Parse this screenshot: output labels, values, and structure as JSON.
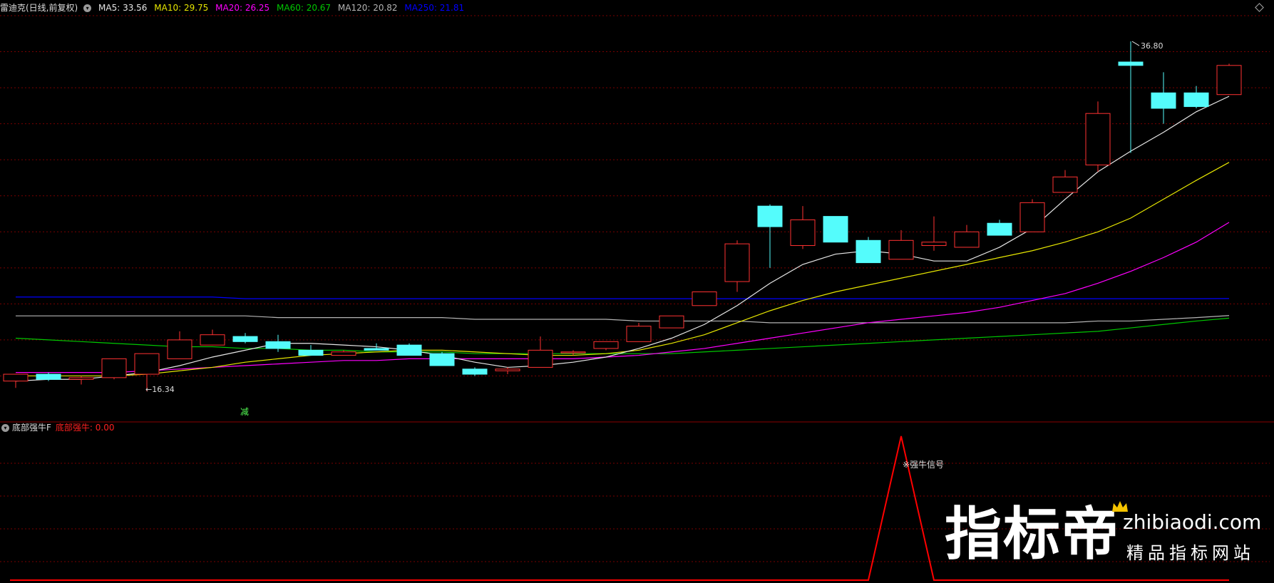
{
  "header": {
    "stock": "雷迪克(日线,前复权)",
    "ma5": "MA5: 33.56",
    "ma10": "MA10: 29.75",
    "ma20": "MA20: 26.25",
    "ma60": "MA60: 20.67",
    "ma120": "MA120: 20.82",
    "ma250": "MA250: 21.81"
  },
  "colors": {
    "up": "#ff3232",
    "down": "#54fcfc",
    "ma5": "#e6e6e6",
    "ma10": "#e6e600",
    "ma20": "#ff00ff",
    "ma60": "#00c800",
    "ma120": "#b4b4b4",
    "ma250": "#0000ff",
    "grid": "#7a0000",
    "signal": "#ff0000"
  },
  "annotations": {
    "high": "36.80",
    "low": "16.34",
    "reduce": "减"
  },
  "indicator": {
    "name": "底部强牛F",
    "label": "底部强牛: 0.00",
    "signal_text": "※强牛信号"
  },
  "watermark": {
    "brand": "指标帝",
    "url": "zhibiaodi.com",
    "tagline": "精品指标网站"
  },
  "chart_data": {
    "type": "candlestick",
    "ylim": [
      15.2,
      38.3
    ],
    "candles": [
      {
        "o": 17.0,
        "h": 17.4,
        "l": 16.6,
        "c": 17.4
      },
      {
        "o": 17.4,
        "h": 17.5,
        "l": 17.0,
        "c": 17.1
      },
      {
        "o": 17.1,
        "h": 17.3,
        "l": 16.8,
        "c": 17.2
      },
      {
        "o": 17.2,
        "h": 18.3,
        "l": 17.1,
        "c": 18.3
      },
      {
        "o": 17.4,
        "h": 18.6,
        "l": 16.4,
        "c": 18.6
      },
      {
        "o": 18.3,
        "h": 19.9,
        "l": 18.3,
        "c": 19.4
      },
      {
        "o": 19.1,
        "h": 20.0,
        "l": 19.1,
        "c": 19.7
      },
      {
        "o": 19.6,
        "h": 19.8,
        "l": 19.2,
        "c": 19.3
      },
      {
        "o": 19.3,
        "h": 19.7,
        "l": 18.7,
        "c": 18.9
      },
      {
        "o": 18.8,
        "h": 19.1,
        "l": 18.5,
        "c": 18.5
      },
      {
        "o": 18.5,
        "h": 18.8,
        "l": 18.5,
        "c": 18.7
      },
      {
        "o": 18.9,
        "h": 19.2,
        "l": 18.8,
        "c": 18.8
      },
      {
        "o": 19.1,
        "h": 19.2,
        "l": 18.5,
        "c": 18.5
      },
      {
        "o": 18.6,
        "h": 18.7,
        "l": 17.9,
        "c": 17.9
      },
      {
        "o": 17.7,
        "h": 17.8,
        "l": 17.3,
        "c": 17.4
      },
      {
        "o": 17.6,
        "h": 17.8,
        "l": 17.4,
        "c": 17.7
      },
      {
        "o": 17.8,
        "h": 19.6,
        "l": 17.8,
        "c": 18.8
      },
      {
        "o": 18.7,
        "h": 18.8,
        "l": 18.5,
        "c": 18.7
      },
      {
        "o": 18.9,
        "h": 19.3,
        "l": 18.8,
        "c": 19.3
      },
      {
        "o": 19.3,
        "h": 20.4,
        "l": 19.3,
        "c": 20.2
      },
      {
        "o": 20.1,
        "h": 20.8,
        "l": 20.1,
        "c": 20.8
      },
      {
        "o": 21.4,
        "h": 22.2,
        "l": 21.4,
        "c": 22.2
      },
      {
        "o": 22.8,
        "h": 25.2,
        "l": 22.2,
        "c": 25.0
      },
      {
        "o": 27.2,
        "h": 27.3,
        "l": 23.6,
        "c": 26.0
      },
      {
        "o": 24.9,
        "h": 27.2,
        "l": 24.7,
        "c": 26.4
      },
      {
        "o": 26.6,
        "h": 26.6,
        "l": 25.1,
        "c": 25.1
      },
      {
        "o": 25.2,
        "h": 25.4,
        "l": 23.9,
        "c": 23.9
      },
      {
        "o": 24.1,
        "h": 25.8,
        "l": 24.1,
        "c": 25.2
      },
      {
        "o": 24.9,
        "h": 26.6,
        "l": 24.6,
        "c": 25.1
      },
      {
        "o": 24.8,
        "h": 26.1,
        "l": 24.8,
        "c": 25.7
      },
      {
        "o": 26.2,
        "h": 26.4,
        "l": 25.5,
        "c": 25.5
      },
      {
        "o": 25.7,
        "h": 27.6,
        "l": 25.7,
        "c": 27.4
      },
      {
        "o": 28.0,
        "h": 29.3,
        "l": 28.0,
        "c": 28.9
      },
      {
        "o": 29.6,
        "h": 33.3,
        "l": 29.2,
        "c": 32.6
      },
      {
        "o": 35.6,
        "h": 36.8,
        "l": 30.3,
        "c": 35.4
      },
      {
        "o": 33.8,
        "h": 35.0,
        "l": 32.0,
        "c": 32.9
      },
      {
        "o": 33.8,
        "h": 34.2,
        "l": 32.9,
        "c": 33.0
      },
      {
        "o": 33.7,
        "h": 35.5,
        "l": 33.7,
        "c": 35.4
      }
    ],
    "ma5": [
      17.0,
      17.1,
      17.1,
      17.3,
      17.5,
      17.9,
      18.4,
      18.8,
      19.2,
      19.2,
      19.1,
      19.0,
      18.8,
      18.5,
      18.1,
      17.8,
      17.9,
      18.1,
      18.4,
      18.9,
      19.5,
      20.3,
      21.4,
      22.7,
      23.8,
      24.4,
      24.6,
      24.4,
      24.0,
      24.0,
      24.8,
      25.9,
      27.6,
      29.2,
      30.4,
      31.5,
      32.7,
      33.6
    ],
    "ma10": [
      17.3,
      17.3,
      17.3,
      17.3,
      17.4,
      17.6,
      17.8,
      18.1,
      18.3,
      18.5,
      18.6,
      18.7,
      18.8,
      18.8,
      18.7,
      18.6,
      18.5,
      18.5,
      18.6,
      18.8,
      19.2,
      19.7,
      20.4,
      21.1,
      21.7,
      22.2,
      22.6,
      23.0,
      23.4,
      23.8,
      24.2,
      24.6,
      25.1,
      25.7,
      26.5,
      27.6,
      28.7,
      29.75
    ],
    "ma20": [
      17.5,
      17.5,
      17.5,
      17.5,
      17.6,
      17.7,
      17.8,
      17.9,
      18.0,
      18.1,
      18.2,
      18.2,
      18.3,
      18.3,
      18.3,
      18.3,
      18.3,
      18.3,
      18.4,
      18.5,
      18.7,
      18.9,
      19.2,
      19.5,
      19.8,
      20.1,
      20.4,
      20.6,
      20.8,
      21.0,
      21.3,
      21.7,
      22.1,
      22.7,
      23.4,
      24.2,
      25.1,
      26.25
    ],
    "ma60": [
      19.5,
      19.4,
      19.3,
      19.2,
      19.1,
      19.0,
      19.0,
      18.9,
      18.9,
      18.8,
      18.8,
      18.7,
      18.7,
      18.7,
      18.6,
      18.6,
      18.6,
      18.6,
      18.6,
      18.6,
      18.6,
      18.7,
      18.8,
      18.9,
      19.0,
      19.1,
      19.2,
      19.3,
      19.4,
      19.5,
      19.6,
      19.7,
      19.8,
      19.9,
      20.1,
      20.3,
      20.5,
      20.67
    ],
    "ma120": [
      20.8,
      20.8,
      20.8,
      20.8,
      20.8,
      20.8,
      20.8,
      20.8,
      20.7,
      20.7,
      20.7,
      20.7,
      20.7,
      20.7,
      20.6,
      20.6,
      20.6,
      20.6,
      20.6,
      20.5,
      20.5,
      20.5,
      20.5,
      20.4,
      20.4,
      20.4,
      20.4,
      20.4,
      20.4,
      20.4,
      20.4,
      20.4,
      20.4,
      20.5,
      20.5,
      20.6,
      20.7,
      20.82
    ],
    "ma250": [
      21.9,
      21.9,
      21.9,
      21.9,
      21.9,
      21.9,
      21.9,
      21.8,
      21.8,
      21.8,
      21.8,
      21.8,
      21.8,
      21.8,
      21.8,
      21.8,
      21.8,
      21.8,
      21.8,
      21.8,
      21.8,
      21.8,
      21.8,
      21.8,
      21.8,
      21.8,
      21.8,
      21.8,
      21.8,
      21.8,
      21.8,
      21.8,
      21.8,
      21.8,
      21.8,
      21.8,
      21.8,
      21.81
    ],
    "indicator_series": {
      "name": "底部强牛",
      "values": [
        0,
        0,
        0,
        0,
        0,
        0,
        0,
        0,
        0,
        0,
        0,
        0,
        0,
        0,
        0,
        0,
        0,
        0,
        0,
        0,
        0,
        0,
        0,
        0,
        0,
        0,
        0,
        1,
        0,
        0,
        0,
        0,
        0,
        0,
        0,
        0,
        0,
        0
      ]
    }
  }
}
